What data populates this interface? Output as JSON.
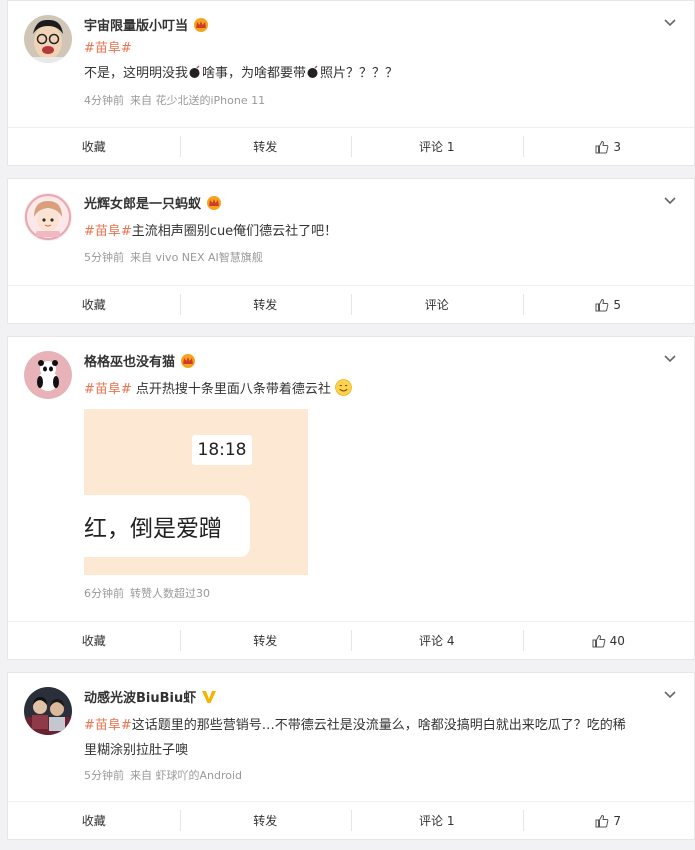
{
  "posts": [
    {
      "user": "宇宙限量版小叮当",
      "topic": "#苗阜#",
      "text_parts": [
        "不是，这明明没我",
        "啥事，为啥都要带",
        "照片？？？？"
      ],
      "time": "4分钟前",
      "source": "来自 花少北送的iPhone 11",
      "actions": {
        "favorite": "收藏",
        "repost": "转发",
        "comment": "评论 1",
        "likes": "3"
      }
    },
    {
      "user": "光辉女郎是一只蚂蚁",
      "topic": "#苗阜#",
      "text": "主流相声圈别cue俺们德云社了吧！",
      "time": "5分钟前",
      "source": "来自 vivo NEX AI智慧旗舰",
      "actions": {
        "favorite": "收藏",
        "repost": "转发",
        "comment": "评论",
        "likes": "5"
      }
    },
    {
      "user": "格格巫也没有猫",
      "topic": "#苗阜#",
      "text": " 点开热搜十条里面八条带着德云社",
      "image_time": "18:18",
      "image_caption": "红，倒是爱蹭",
      "time": "6分钟前",
      "source": "转赞人数超过30",
      "actions": {
        "favorite": "收藏",
        "repost": "转发",
        "comment": "评论 4",
        "likes": "40"
      }
    },
    {
      "user": "动感光波BiuBiu虾",
      "topic": "#苗阜#",
      "text_line1": "这话题里的那些营销号…不带德云社是没流量么，啥都没搞明白就出来吃瓜了？吃的稀",
      "text_line2": "里糊涂别拉肚子噢",
      "time": "5分钟前",
      "source": "来自 虾球吖的Android",
      "actions": {
        "favorite": "收藏",
        "repost": "转发",
        "comment": "评论 1",
        "likes": "7"
      }
    }
  ],
  "colors": {
    "topic": "#eb7350",
    "crown": "#f7a31c",
    "verified": "#f5b400"
  }
}
